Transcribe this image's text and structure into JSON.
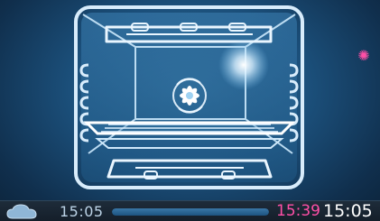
{
  "display": {
    "mode_icon": "defrost-snowflake-icon",
    "accent_color": "#ff4fa6"
  },
  "statusbar": {
    "cloud_icon": "cloud-icon",
    "start_time": "15:05",
    "end_time": "15:39",
    "clock": "15:05",
    "progress": 0.0
  }
}
